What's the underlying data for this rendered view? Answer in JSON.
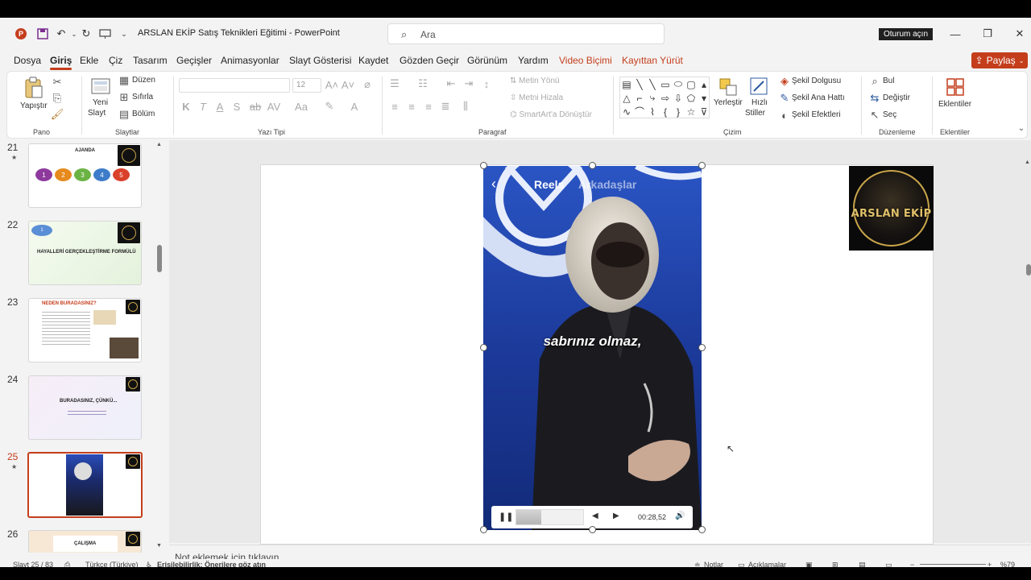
{
  "window": {
    "title": "ARSLAN EKİP Satış Teknikleri Eğitimi  -  PowerPoint",
    "search_placeholder": "Ara",
    "signin_label": "Oturum açın",
    "app_logo": "P"
  },
  "menu": {
    "tabs": [
      "Dosya",
      "Giriş",
      "Ekle",
      "Çiz",
      "Tasarım",
      "Geçişler",
      "Animasyonlar",
      "Slayt Gösterisi",
      "Kaydet",
      "Gözden Geçir",
      "Görünüm",
      "Yardım",
      "Video Biçimi",
      "Kayıttan Yürüt"
    ],
    "active": "Giriş",
    "share_label": "Paylaş"
  },
  "ribbon": {
    "paste": "Yapıştır",
    "new_slide_line1": "Yeni",
    "new_slide_line2": "Slayt",
    "layout": "Düzen",
    "reset": "Sıfırla",
    "section": "Bölüm",
    "font_size": "12",
    "text_direction": "Metin Yönü",
    "align_text": "Metni Hizala",
    "smartart": "SmartArt'a Dönüştür",
    "arrange": "Yerleştir",
    "quick_styles_line1": "Hızlı",
    "quick_styles_line2": "Stiller",
    "shape_fill": "Şekil Dolgusu",
    "shape_outline": "Şekil Ana Hattı",
    "shape_effects": "Şekil Efektleri",
    "find": "Bul",
    "replace": "Değiştir",
    "select": "Seç",
    "addins": "Eklentiler",
    "groups": {
      "clipboard": "Pano",
      "slides": "Slaytlar",
      "font": "Yazı Tipi",
      "paragraph": "Paragraf",
      "drawing": "Çizim",
      "editing": "Düzenleme",
      "addins": "Eklentiler"
    },
    "font_buttons": [
      "K",
      "T",
      "A",
      "S",
      "ab",
      "AV",
      "Aa"
    ]
  },
  "thumbnails": [
    {
      "num": "21",
      "title": "AJANDA",
      "starred": true,
      "selected": false,
      "steps": [
        "1",
        "2",
        "3",
        "4",
        "5"
      ]
    },
    {
      "num": "22",
      "title": "HAYALLERİ GERÇEKLEŞTİRME FORMÜLÜ",
      "badge": "1",
      "starred": false,
      "selected": false
    },
    {
      "num": "23",
      "title": "NEDEN BURADASINIZ?",
      "starred": false,
      "selected": false
    },
    {
      "num": "24",
      "title": "BURADASINIZ, ÇÜNKÜ...",
      "starred": false,
      "selected": false
    },
    {
      "num": "25",
      "title": "",
      "starred": true,
      "selected": true
    },
    {
      "num": "26",
      "title": "ÇALIŞMA",
      "starred": false,
      "selected": false
    }
  ],
  "video": {
    "reels_title": "Reels",
    "reels_friends": "Arkadaşlar",
    "subtitle": "sabrınız olmaz,",
    "time": "00:28,52",
    "progress": 0.37
  },
  "logo_text": "ARSLAN EKİP",
  "notes_placeholder": "Not eklemek için tıklayın",
  "status": {
    "slide_info": "Slayt 25 / 83",
    "language": "Türkçe (Türkiye)",
    "accessibility": "Erişilebilirlik: Önerilere göz atın",
    "notes": "Notlar",
    "comments": "Açıklamalar",
    "zoom": "%79"
  },
  "colors": {
    "accent": "#c43e1c",
    "video_bg": "#1f3fa6"
  }
}
